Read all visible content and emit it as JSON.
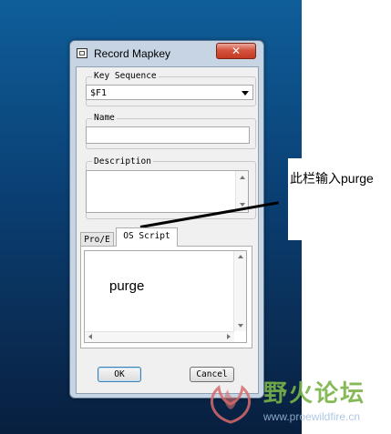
{
  "annotation": {
    "note": "此栏输入purge"
  },
  "dialog": {
    "title": "Record Mapkey",
    "close_symbol": "✕",
    "key_sequence": {
      "label": "Key Sequence",
      "value": "$F1"
    },
    "name": {
      "label": "Name",
      "value": ""
    },
    "description": {
      "label": "Description",
      "value": ""
    },
    "tabs": [
      {
        "label": "Pro/E",
        "active": false
      },
      {
        "label": "OS Script",
        "active": true
      }
    ],
    "script_content": "purge",
    "ok_label": "OK",
    "cancel_label": "Cancel"
  },
  "watermark": {
    "text": "野火论坛",
    "url": "www.proewildfire.cn"
  },
  "colors": {
    "desktop_top": "#0f5e9a",
    "desktop_bottom": "#081f3f",
    "window_frame": "#c6d4e4",
    "close_button": "#c43a22",
    "watermark_green": "#7ab348"
  }
}
